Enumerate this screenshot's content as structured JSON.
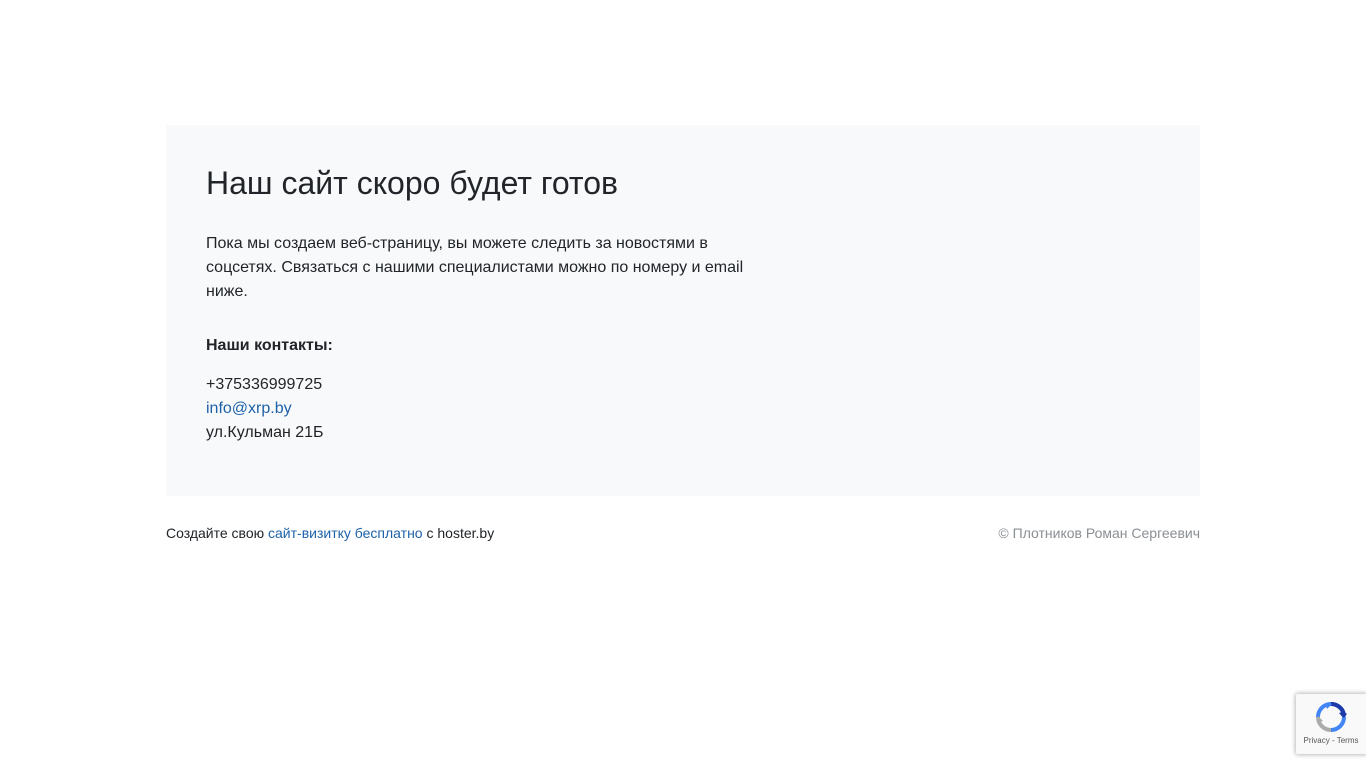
{
  "main": {
    "title": "Наш сайт скоро будет готов",
    "intro": "Пока мы создаем веб-страницу, вы можете следить за новостями в соцсетях. Связаться с нашими специалистами можно по номеру и email ниже.",
    "contacts_title": "Наши контакты:",
    "phone": "+375336999725",
    "email": "info@xrp.by",
    "address": "ул.Кульман 21Б"
  },
  "footer": {
    "left_prefix": "Создайте свою",
    "left_link": "сайт-визитку бесплатно",
    "left_suffix": "с hoster.by",
    "copyright": "© Плотников Роман Сергеевич"
  },
  "recaptcha": {
    "icon": "recaptcha-logo-icon",
    "privacy": "Privacy",
    "separator": "-",
    "terms": "Terms"
  },
  "colors": {
    "card_background": "#f8f9fa",
    "link": "#1d62a8",
    "text": "#212529",
    "muted": "#8a8f94"
  }
}
